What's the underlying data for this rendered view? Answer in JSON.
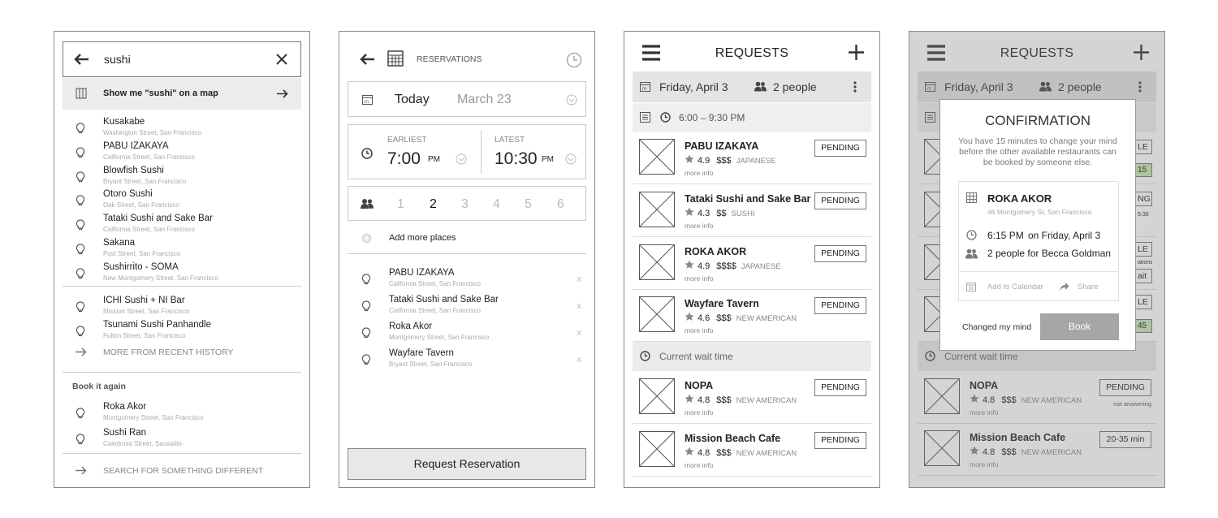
{
  "screen1": {
    "search": {
      "value": "sushi"
    },
    "map_prompt": "Show me \"sushi\" on a map",
    "results": [
      {
        "name": "Kusakabe",
        "street": "Washington Street, San Francisco"
      },
      {
        "name": "PABU IZAKAYA",
        "street": "California Street, San Francisco"
      },
      {
        "name": "Blowfish Sushi",
        "street": "Bryant Street, San Francisco"
      },
      {
        "name": "Otoro Sushi",
        "street": "Oak Street, San Francisco"
      },
      {
        "name": "Tataki Sushi and Sake Bar",
        "street": "California Street, San Francisco"
      },
      {
        "name": "Sakana",
        "street": "Post Street, San Francisco"
      },
      {
        "name": "Sushirrito - SOMA",
        "street": "New Montgomery Street, San Francisco"
      }
    ],
    "recent": [
      {
        "name": "ICHI Sushi + NI Bar",
        "street": "Mission Street, San Francisco"
      },
      {
        "name": "Tsunami Sushi Panhandle",
        "street": "Fulton Street, San Francisco"
      }
    ],
    "more_history": "MORE FROM RECENT HISTORY",
    "book_again_label": "Book it again",
    "book_again": [
      {
        "name": "Roka Akor",
        "street": "Montgomery Street, San Francisco"
      },
      {
        "name": "Sushi Ran",
        "street": "Caledonia Street, Sausalito"
      }
    ],
    "search_different": "SEARCH FOR SOMETHING DIFFERENT"
  },
  "screen2": {
    "title": "RESERVATIONS",
    "date_today": "Today",
    "date_value": "March 23",
    "earliest_label": "EARLIEST",
    "earliest_time": "7:00",
    "earliest_ampm": "PM",
    "latest_label": "LATEST",
    "latest_time": "10:30",
    "latest_ampm": "PM",
    "party_sizes": [
      "1",
      "2",
      "3",
      "4",
      "5",
      "6"
    ],
    "party_selected": "2",
    "add_more": "Add more places",
    "places": [
      {
        "name": "PABU IZAKAYA",
        "street": "California Street, San Francisco",
        "remove": "x"
      },
      {
        "name": "Tataki Sushi and Sake Bar",
        "street": "California Street, San Francisco",
        "remove": "x"
      },
      {
        "name": "Roka Akor",
        "street": "Montgomery Street, San Francisco",
        "remove": "x"
      },
      {
        "name": "Wayfare Tavern",
        "street": "Bryant Street, San Francisco",
        "remove": "x"
      }
    ],
    "request_button": "Request Reservation"
  },
  "screen3": {
    "title": "REQUESTS",
    "date": "Friday, April 3",
    "people": "2 people",
    "time_range": "6:00 – 9:30 PM",
    "restaurants": [
      {
        "name": "PABU IZAKAYA",
        "rating": "4.9",
        "price": "$$$",
        "cuisine": "JAPANESE",
        "more": "more info",
        "status": "PENDING"
      },
      {
        "name": "Tataki Sushi and Sake Bar",
        "rating": "4.3",
        "price": "$$",
        "cuisine": "SUSHI",
        "more": "more info",
        "status": "PENDING"
      },
      {
        "name": "ROKA AKOR",
        "rating": "4.9",
        "price": "$$$$",
        "cuisine": "JAPANESE",
        "more": "more info",
        "status": "PENDING"
      },
      {
        "name": "Wayfare Tavern",
        "rating": "4.6",
        "price": "$$$",
        "cuisine": "NEW AMERICAN",
        "more": "more info",
        "status": "PENDING"
      }
    ],
    "wait_label": "Current wait time",
    "wait_restaurants": [
      {
        "name": "NOPA",
        "rating": "4.8",
        "price": "$$$",
        "cuisine": "NEW AMERICAN",
        "more": "more info",
        "status": "PENDING"
      },
      {
        "name": "Mission Beach Cafe",
        "rating": "4.8",
        "price": "$$$",
        "cuisine": "NEW AMERICAN",
        "more": "more info",
        "status": "PENDING"
      }
    ]
  },
  "screen4": {
    "title": "REQUESTS",
    "date": "Friday, April 3",
    "people": "2 people",
    "peek_badges": [
      "LE",
      "15",
      "NG",
      "5:30",
      "LE",
      "ations",
      "ait",
      "LE",
      "45"
    ],
    "wait_label": "Current wait time",
    "wait_restaurants": [
      {
        "name": "NOPA",
        "rating": "4.8",
        "price": "$$$",
        "cuisine": "NEW AMERICAN",
        "more": "more info",
        "status": "PENDING",
        "note": "not answering"
      },
      {
        "name": "Mission Beach Cafe",
        "rating": "4.8",
        "price": "$$$",
        "cuisine": "NEW AMERICAN",
        "more": "more info",
        "status": "20-35 min"
      }
    ],
    "modal": {
      "title": "CONFIRMATION",
      "message": "You have 15 minutes to change your mind before the other available restaurants can be booked by someone else.",
      "restaurant": "ROKA AKOR",
      "address": "46 Montgomery St, San Francisco",
      "time": "6:15 PM",
      "day": "on Friday, April 3",
      "party": "2 people for Becca Goldman",
      "add_calendar": "Add to Calendar",
      "share": "Share",
      "cancel": "Changed my mind",
      "book": "Book"
    }
  },
  "colors": {
    "border": "#8a8a8a",
    "band": "#e4e4e4",
    "book_button": "#a6a6a6",
    "green_badge": "#c8e6b4"
  }
}
